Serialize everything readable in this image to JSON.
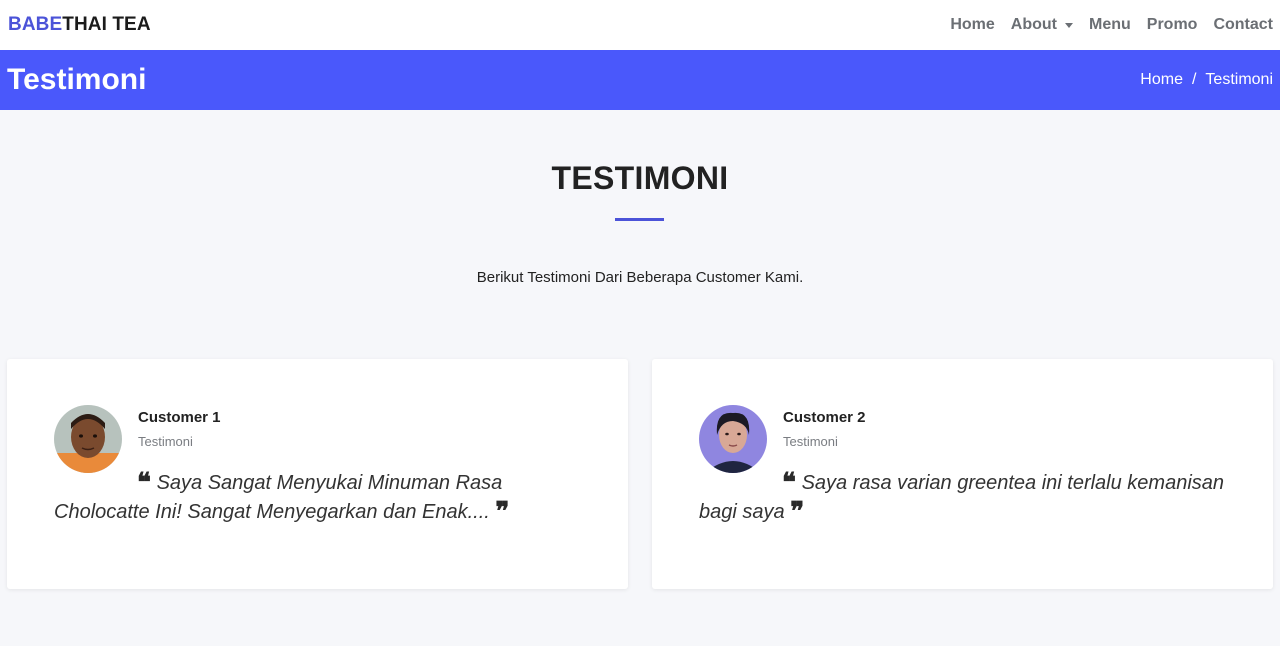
{
  "navbar": {
    "brand_part1": "BABE",
    "brand_part2": "THAI TEA",
    "items": [
      {
        "label": "Home"
      },
      {
        "label": "About"
      },
      {
        "label": "Menu"
      },
      {
        "label": "Promo"
      },
      {
        "label": "Contact"
      }
    ]
  },
  "page_header": {
    "title": "Testimoni",
    "breadcrumb": [
      "Home",
      "/",
      "Testimoni"
    ]
  },
  "section": {
    "title": "TESTIMONI",
    "subtitle": "Berikut Testimoni Dari Beberapa Customer Kami."
  },
  "testimonials": [
    {
      "name": "Customer 1",
      "role": "Testimoni",
      "text": "Saya Sangat Menyukai Minuman Rasa Cholocatte Ini! Sangat Menyegarkan dan Enak...."
    },
    {
      "name": "Customer 2",
      "role": "Testimoni",
      "text": "Saya rasa varian greentea ini terlalu kemanisan bagi saya"
    }
  ],
  "colors": {
    "accent": "#4a58fb",
    "brand": "#4b53d8"
  },
  "icons": {
    "quote_open": "❝",
    "quote_close": "❞"
  }
}
